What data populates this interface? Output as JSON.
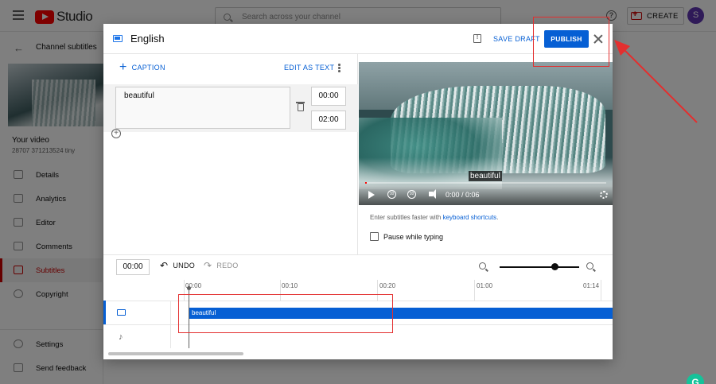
{
  "app": {
    "brand": "Studio",
    "search_placeholder": "Search across your channel",
    "create_label": "CREATE",
    "avatar_letter": "S"
  },
  "sidebar": {
    "back_label": "Channel subtitles",
    "your_video": "Your video",
    "video_id": "28707 371213524 tiny",
    "items": [
      {
        "label": "Details",
        "icon": "pencil-icon"
      },
      {
        "label": "Analytics",
        "icon": "bar-chart-icon"
      },
      {
        "label": "Editor",
        "icon": "film-icon"
      },
      {
        "label": "Comments",
        "icon": "comment-icon"
      },
      {
        "label": "Subtitles",
        "icon": "subtitles-icon",
        "active": true
      },
      {
        "label": "Copyright",
        "icon": "copyright-icon"
      }
    ],
    "bottom": [
      {
        "label": "Settings",
        "icon": "gear-icon"
      },
      {
        "label": "Send feedback",
        "icon": "feedback-icon"
      }
    ]
  },
  "modal": {
    "title": "English",
    "save_draft": "SAVE DRAFT",
    "publish": "PUBLISH",
    "add_caption": "CAPTION",
    "edit_as_text": "EDIT AS TEXT",
    "caption": {
      "text": "beautiful",
      "start": "00:00",
      "end": "02:00"
    },
    "video": {
      "caption_overlay": "beautiful",
      "time": "0:00 / 0:06",
      "rewind_label": "10",
      "forward_label": "10"
    },
    "help_text_prefix": "Enter subtitles faster with ",
    "help_link": "keyboard shortcuts",
    "help_text_suffix": ".",
    "pause_label": "Pause while typing"
  },
  "timeline": {
    "current_time": "00:00",
    "undo": "UNDO",
    "redo": "REDO",
    "ticks": [
      "00:00",
      "00:10",
      "00:20",
      "01:00",
      "01:14"
    ],
    "caption_block": "beautiful"
  },
  "colors": {
    "accent": "#065fd4",
    "brand_red": "#ff0000",
    "annotation_red": "#e32f2f"
  }
}
